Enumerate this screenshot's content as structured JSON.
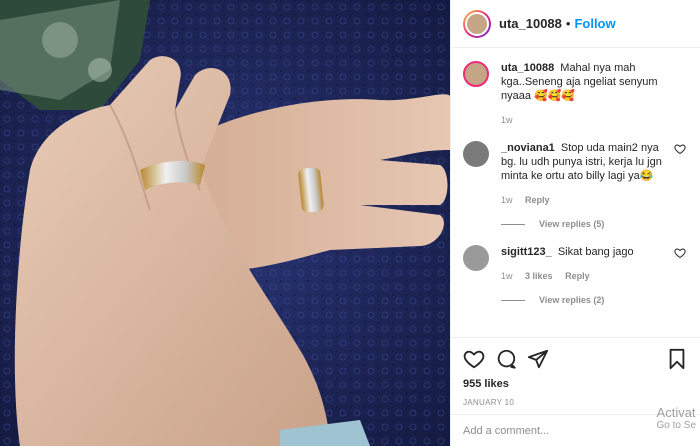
{
  "post": {
    "username": "uta_10088",
    "separator": "•",
    "follow_label": "Follow"
  },
  "comments": [
    {
      "username": "uta_10088",
      "text": "Mahal nya mah kga..Seneng aja ngeliat senyum nyaaa 🥰🥰🥰",
      "time": "1w"
    },
    {
      "username": "_noviana1",
      "text": "Stop uda main2 nya bg. lu udh punya istri, kerja lu jgn minta ke ortu ato billy lagi ya😂",
      "time": "1w",
      "reply_label": "Reply",
      "view_replies": "View replies (5)"
    },
    {
      "username": "sigitt123_",
      "text": "Sikat bang jago",
      "time": "1w",
      "likes": "3 likes",
      "reply_label": "Reply",
      "view_replies": "View replies (2)"
    }
  ],
  "likes_count": "955 likes",
  "post_date": "JANUARY 10",
  "add_comment_placeholder": "Add a comment...",
  "watermark": {
    "line1": "Activat",
    "line2": "Go to Se"
  },
  "colors": {
    "accent": "#0095f6",
    "secondary_text": "#8e8e8e",
    "border": "#efefef"
  }
}
